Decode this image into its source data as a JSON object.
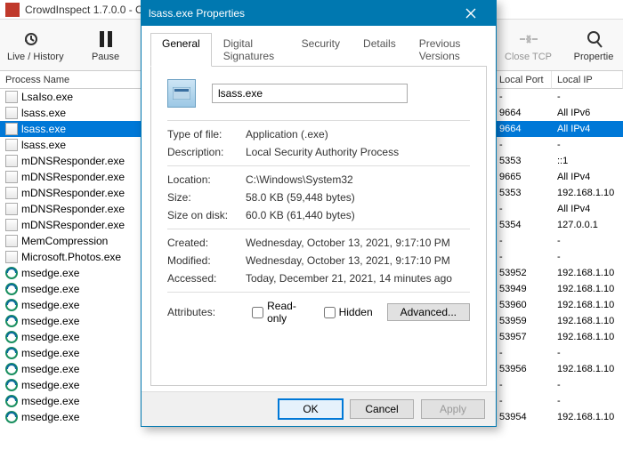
{
  "main": {
    "title": "CrowdInspect 1.7.0.0 - C",
    "toolbar": {
      "live_history": "Live / History",
      "pause": "Pause",
      "close_tcp": "Close TCP",
      "properties": "Propertie"
    },
    "columns": {
      "process_name": "Process Name",
      "local_port": "Local Port",
      "local_ip": "Local IP"
    },
    "rows": [
      {
        "name": "LsaIso.exe",
        "icon": "generic",
        "port": "-",
        "ip": "-"
      },
      {
        "name": "lsass.exe",
        "icon": "generic",
        "port": "9664",
        "ip": "All IPv6"
      },
      {
        "name": "lsass.exe",
        "icon": "generic",
        "port": "9664",
        "ip": "All IPv4",
        "selected": true
      },
      {
        "name": "lsass.exe",
        "icon": "generic",
        "port": "-",
        "ip": "-"
      },
      {
        "name": "mDNSResponder.exe",
        "icon": "generic",
        "port": "5353",
        "ip": "::1"
      },
      {
        "name": "mDNSResponder.exe",
        "icon": "generic",
        "port": "9665",
        "ip": "All IPv4"
      },
      {
        "name": "mDNSResponder.exe",
        "icon": "generic",
        "port": "5353",
        "ip": "192.168.1.10"
      },
      {
        "name": "mDNSResponder.exe",
        "icon": "generic",
        "port": "-",
        "ip": "All IPv4"
      },
      {
        "name": "mDNSResponder.exe",
        "icon": "generic",
        "port": "5354",
        "ip": "127.0.0.1"
      },
      {
        "name": "MemCompression",
        "icon": "generic",
        "port": "-",
        "ip": "-"
      },
      {
        "name": "Microsoft.Photos.exe",
        "icon": "generic",
        "port": "-",
        "ip": "-"
      },
      {
        "name": "msedge.exe",
        "icon": "edge",
        "port": "53952",
        "ip": "192.168.1.10"
      },
      {
        "name": "msedge.exe",
        "icon": "edge",
        "port": "53949",
        "ip": "192.168.1.10"
      },
      {
        "name": "msedge.exe",
        "icon": "edge",
        "port": "53960",
        "ip": "192.168.1.10"
      },
      {
        "name": "msedge.exe",
        "icon": "edge",
        "port": "53959",
        "ip": "192.168.1.10"
      },
      {
        "name": "msedge.exe",
        "icon": "edge",
        "port": "53957",
        "ip": "192.168.1.10"
      },
      {
        "name": "msedge.exe",
        "icon": "edge",
        "port": "-",
        "ip": "-"
      },
      {
        "name": "msedge.exe",
        "icon": "edge",
        "port": "53956",
        "ip": "192.168.1.10"
      },
      {
        "name": "msedge.exe",
        "icon": "edge",
        "port": "-",
        "ip": "-"
      },
      {
        "name": "msedge.exe",
        "icon": "edge",
        "port": "-",
        "ip": "-"
      },
      {
        "name": "msedge.exe",
        "icon": "edge",
        "port": "53954",
        "ip": "192.168.1.10"
      }
    ]
  },
  "dialog": {
    "title": "lsass.exe Properties",
    "tabs": [
      "General",
      "Digital Signatures",
      "Security",
      "Details",
      "Previous Versions"
    ],
    "filename": "lsass.exe",
    "props": {
      "type_label": "Type of file:",
      "type_val": "Application (.exe)",
      "desc_label": "Description:",
      "desc_val": "Local Security Authority Process",
      "loc_label": "Location:",
      "loc_val": "C:\\Windows\\System32",
      "size_label": "Size:",
      "size_val": "58.0 KB (59,448 bytes)",
      "disk_label": "Size on disk:",
      "disk_val": "60.0 KB (61,440 bytes)",
      "created_label": "Created:",
      "created_val": "Wednesday, October 13, 2021, 9:17:10 PM",
      "modified_label": "Modified:",
      "modified_val": "Wednesday, October 13, 2021, 9:17:10 PM",
      "accessed_label": "Accessed:",
      "accessed_val": "Today, December 21, 2021, 14 minutes ago",
      "attr_label": "Attributes:",
      "readonly": "Read-only",
      "hidden": "Hidden",
      "advanced": "Advanced..."
    },
    "buttons": {
      "ok": "OK",
      "cancel": "Cancel",
      "apply": "Apply"
    }
  }
}
